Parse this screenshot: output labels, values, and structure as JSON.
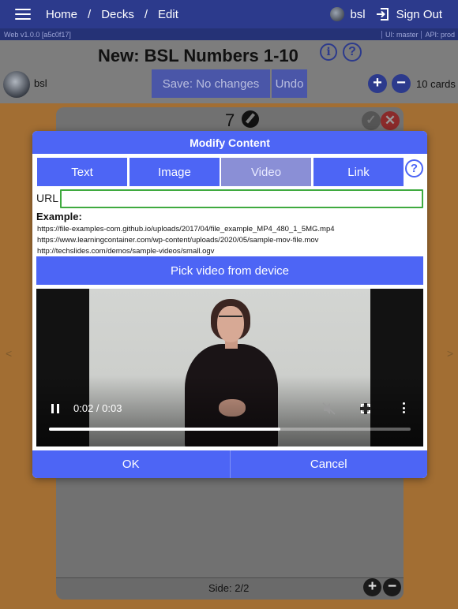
{
  "topbar": {
    "breadcrumbs": [
      "Home",
      "Decks",
      "Edit"
    ],
    "separator": "/",
    "user": "bsl",
    "signout_label": "Sign Out"
  },
  "versionbar": {
    "web": "Web v1.0.0 [a5c0f17]",
    "ui": "UI: master",
    "api": "API: prod"
  },
  "deck": {
    "title": "New: BSL Numbers 1-10",
    "owner": "bsl",
    "save_label": "Save: No changes",
    "undo_label": "Undo",
    "add_symbol": "+",
    "remove_symbol": "−",
    "card_count": "10 cards"
  },
  "card": {
    "number": "7",
    "side_label": "Side: 2/2",
    "check_symbol": "✓",
    "close_symbol": "✕",
    "nav_prev": "<",
    "nav_next": ">"
  },
  "modal": {
    "title": "Modify Content",
    "tabs": [
      {
        "label": "Text",
        "active": false
      },
      {
        "label": "Image",
        "active": false
      },
      {
        "label": "Video",
        "active": true
      },
      {
        "label": "Link",
        "active": false
      }
    ],
    "help_symbol": "?",
    "url_label": "URL",
    "url_value": "",
    "example_label": "Example:",
    "examples": [
      "https://file-examples-com.github.io/uploads/2017/04/file_example_MP4_480_1_5MG.mp4",
      "https://www.learningcontainer.com/wp-content/uploads/2020/05/sample-mov-file.mov",
      "http://techslides.com/demos/sample-videos/small.ogv"
    ],
    "pick_label": "Pick video from device",
    "video": {
      "time": "0:02 / 0:03",
      "progress": 0.64
    },
    "ok_label": "OK",
    "cancel_label": "Cancel"
  },
  "colors": {
    "accent": "#4d65f5",
    "topbar": "#2c3a8c",
    "valid_border": "#3faa3f"
  },
  "icons": [
    "menu-icon",
    "avatar-icon",
    "sign-out-icon",
    "info-icon",
    "help-icon",
    "plus-icon",
    "minus-icon",
    "pencil-icon",
    "check-icon",
    "close-icon",
    "pause-icon",
    "mute-icon",
    "fullscreen-icon",
    "more-icon"
  ]
}
